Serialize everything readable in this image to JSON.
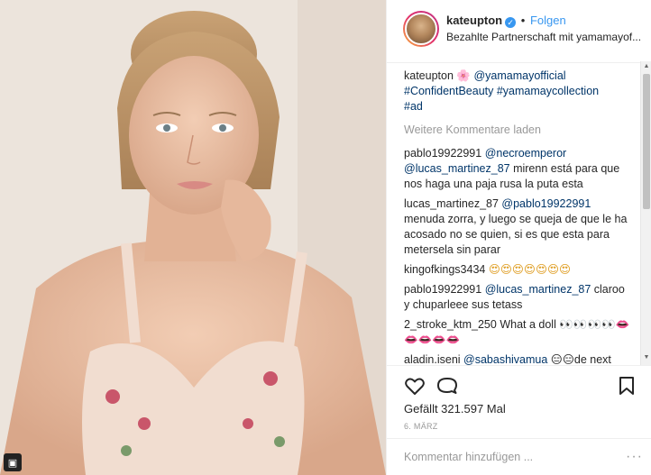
{
  "post": {
    "username": "kateupton",
    "follow_label": "Folgen",
    "dot": "•",
    "subtitle": "Bezahlte Partnerschaft mit yamamayof..."
  },
  "caption": {
    "username": "kateupton",
    "flower": "🌸",
    "mention": "@yamamayofficial",
    "tags": "#ConfidentBeauty #yamamaycollection",
    "tag2": "#ad"
  },
  "load_more": "Weitere Kommentare laden",
  "comments": [
    {
      "username": "pablo19922991",
      "mention": "@necroemperor @lucas_martinez_87",
      "text": " mirenn está para que nos haga una paja rusa la puta esta"
    },
    {
      "username": "lucas_martinez_87",
      "mention": "@pablo19922991",
      "text": " menuda zorra, y luego se queja de que le ha acosado no se quien, si es que esta para metersela sin parar"
    },
    {
      "username": "kingofkings3434",
      "mention": "",
      "text": " 😍😍😍😍😍😍😍"
    },
    {
      "username": "pablo19922991",
      "mention": "@lucas_martinez_87",
      "text": " claroo y chuparleee sus tetass"
    },
    {
      "username": "2_stroke_ktm_250",
      "mention": "",
      "text": " What a doll 👀👀👀👀👄👄👄👄👄"
    },
    {
      "username": "aladin.iseni",
      "mention": "@sabashivamua",
      "text": " 😑😑de next one"
    }
  ],
  "likes": "Gefällt 321.597 Mal",
  "date": "6. MÄRZ",
  "comment_placeholder": "Kommentar hinzufügen ...",
  "more_label": "···",
  "icons": {
    "like": "heart-icon",
    "comment": "comment-icon",
    "save": "bookmark-icon",
    "verified": "verified-badge-icon",
    "multi": "gallery-icon"
  },
  "colors": {
    "link": "#003569",
    "follow": "#3897f0",
    "muted": "#999999"
  }
}
